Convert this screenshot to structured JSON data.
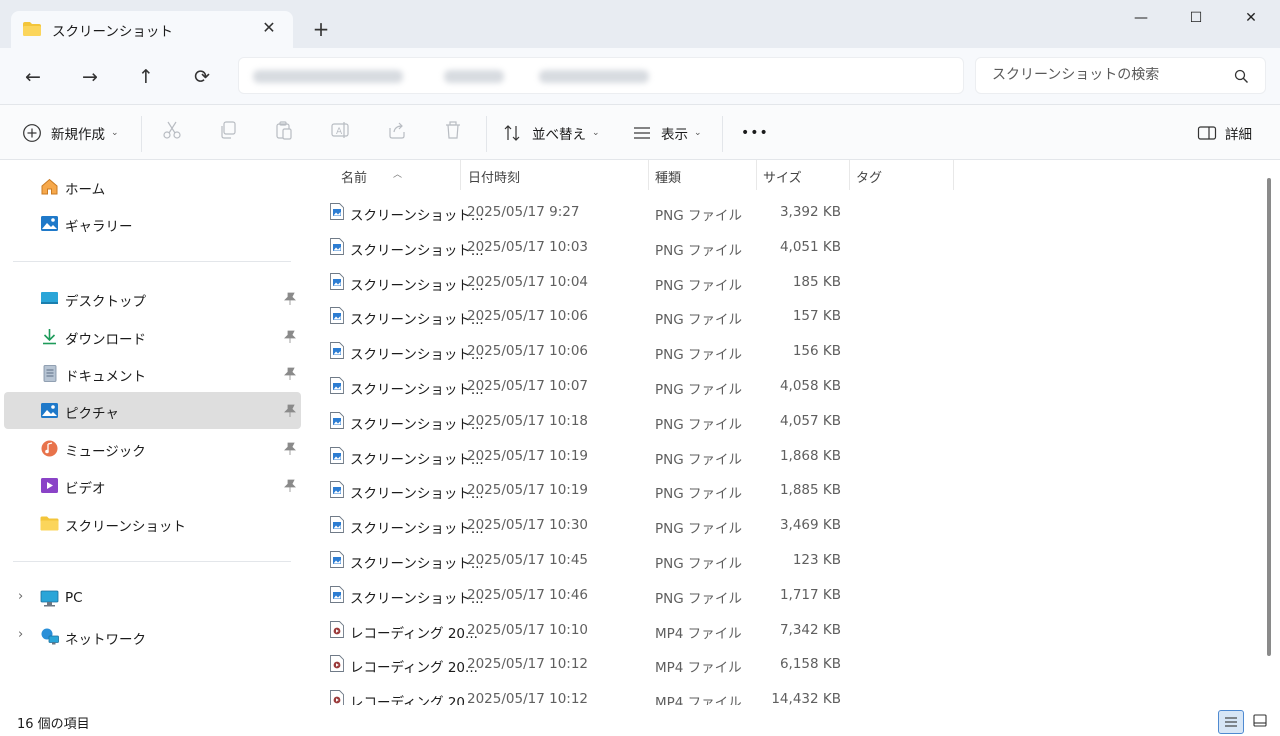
{
  "window": {
    "tab_title": "スクリーンショット",
    "tab_close": "✕",
    "new_tab": "+",
    "minimize": "—",
    "maximize": "☐",
    "close": "✕"
  },
  "nav": {
    "back": "←",
    "forward": "→",
    "up": "↑",
    "refresh": "⟳"
  },
  "search": {
    "placeholder": "スクリーンショットの検索"
  },
  "toolbar": {
    "new_label": "新規作成",
    "sort_label": "並べ替え",
    "view_label": "表示",
    "more": "•••",
    "details_label": "詳細"
  },
  "sidebar": {
    "items": [
      {
        "label": "ホーム",
        "icon": "home-icon"
      },
      {
        "label": "ギャラリー",
        "icon": "gallery-icon"
      },
      {
        "label": "デスクトップ",
        "icon": "desktop-icon",
        "pinned": true
      },
      {
        "label": "ダウンロード",
        "icon": "download-icon",
        "pinned": true
      },
      {
        "label": "ドキュメント",
        "icon": "document-icon",
        "pinned": true
      },
      {
        "label": "ピクチャ",
        "icon": "pictures-icon",
        "pinned": true,
        "selected": true
      },
      {
        "label": "ミュージック",
        "icon": "music-icon",
        "pinned": true
      },
      {
        "label": "ビデオ",
        "icon": "video-icon",
        "pinned": true
      },
      {
        "label": "スクリーンショット",
        "icon": "folder-icon"
      },
      {
        "label": "PC",
        "icon": "pc-icon",
        "expandable": true
      },
      {
        "label": "ネットワーク",
        "icon": "network-icon",
        "expandable": true
      }
    ]
  },
  "columns": {
    "name": "名前",
    "date": "日付時刻",
    "type": "種類",
    "size": "サイズ",
    "tag": "タグ"
  },
  "files": [
    {
      "name": "スクリーンショット...",
      "date": "2025/05/17 9:27",
      "type": "PNG ファイル",
      "size": "3,392 KB",
      "kind": "png"
    },
    {
      "name": "スクリーンショット...",
      "date": "2025/05/17 10:03",
      "type": "PNG ファイル",
      "size": "4,051 KB",
      "kind": "png"
    },
    {
      "name": "スクリーンショット...",
      "date": "2025/05/17 10:04",
      "type": "PNG ファイル",
      "size": "185 KB",
      "kind": "png"
    },
    {
      "name": "スクリーンショット...",
      "date": "2025/05/17 10:06",
      "type": "PNG ファイル",
      "size": "157 KB",
      "kind": "png"
    },
    {
      "name": "スクリーンショット...",
      "date": "2025/05/17 10:06",
      "type": "PNG ファイル",
      "size": "156 KB",
      "kind": "png"
    },
    {
      "name": "スクリーンショット...",
      "date": "2025/05/17 10:07",
      "type": "PNG ファイル",
      "size": "4,058 KB",
      "kind": "png"
    },
    {
      "name": "スクリーンショット...",
      "date": "2025/05/17 10:18",
      "type": "PNG ファイル",
      "size": "4,057 KB",
      "kind": "png"
    },
    {
      "name": "スクリーンショット...",
      "date": "2025/05/17 10:19",
      "type": "PNG ファイル",
      "size": "1,868 KB",
      "kind": "png"
    },
    {
      "name": "スクリーンショット...",
      "date": "2025/05/17 10:19",
      "type": "PNG ファイル",
      "size": "1,885 KB",
      "kind": "png"
    },
    {
      "name": "スクリーンショット...",
      "date": "2025/05/17 10:30",
      "type": "PNG ファイル",
      "size": "3,469 KB",
      "kind": "png"
    },
    {
      "name": "スクリーンショット...",
      "date": "2025/05/17 10:45",
      "type": "PNG ファイル",
      "size": "123 KB",
      "kind": "png"
    },
    {
      "name": "スクリーンショット...",
      "date": "2025/05/17 10:46",
      "type": "PNG ファイル",
      "size": "1,717 KB",
      "kind": "png"
    },
    {
      "name": "レコーディング 20...",
      "date": "2025/05/17 10:10",
      "type": "MP4 ファイル",
      "size": "7,342 KB",
      "kind": "mp4"
    },
    {
      "name": "レコーディング 20...",
      "date": "2025/05/17 10:12",
      "type": "MP4 ファイル",
      "size": "6,158 KB",
      "kind": "mp4"
    },
    {
      "name": "レコーディング 20...",
      "date": "2025/05/17 10:12",
      "type": "MP4 ファイル",
      "size": "14,432 KB",
      "kind": "mp4"
    }
  ],
  "status": {
    "count": "16 個の項目"
  },
  "colors": {
    "titlebar": "#e8ecf2",
    "selected": "#dedede",
    "accent": "#0067c0"
  }
}
